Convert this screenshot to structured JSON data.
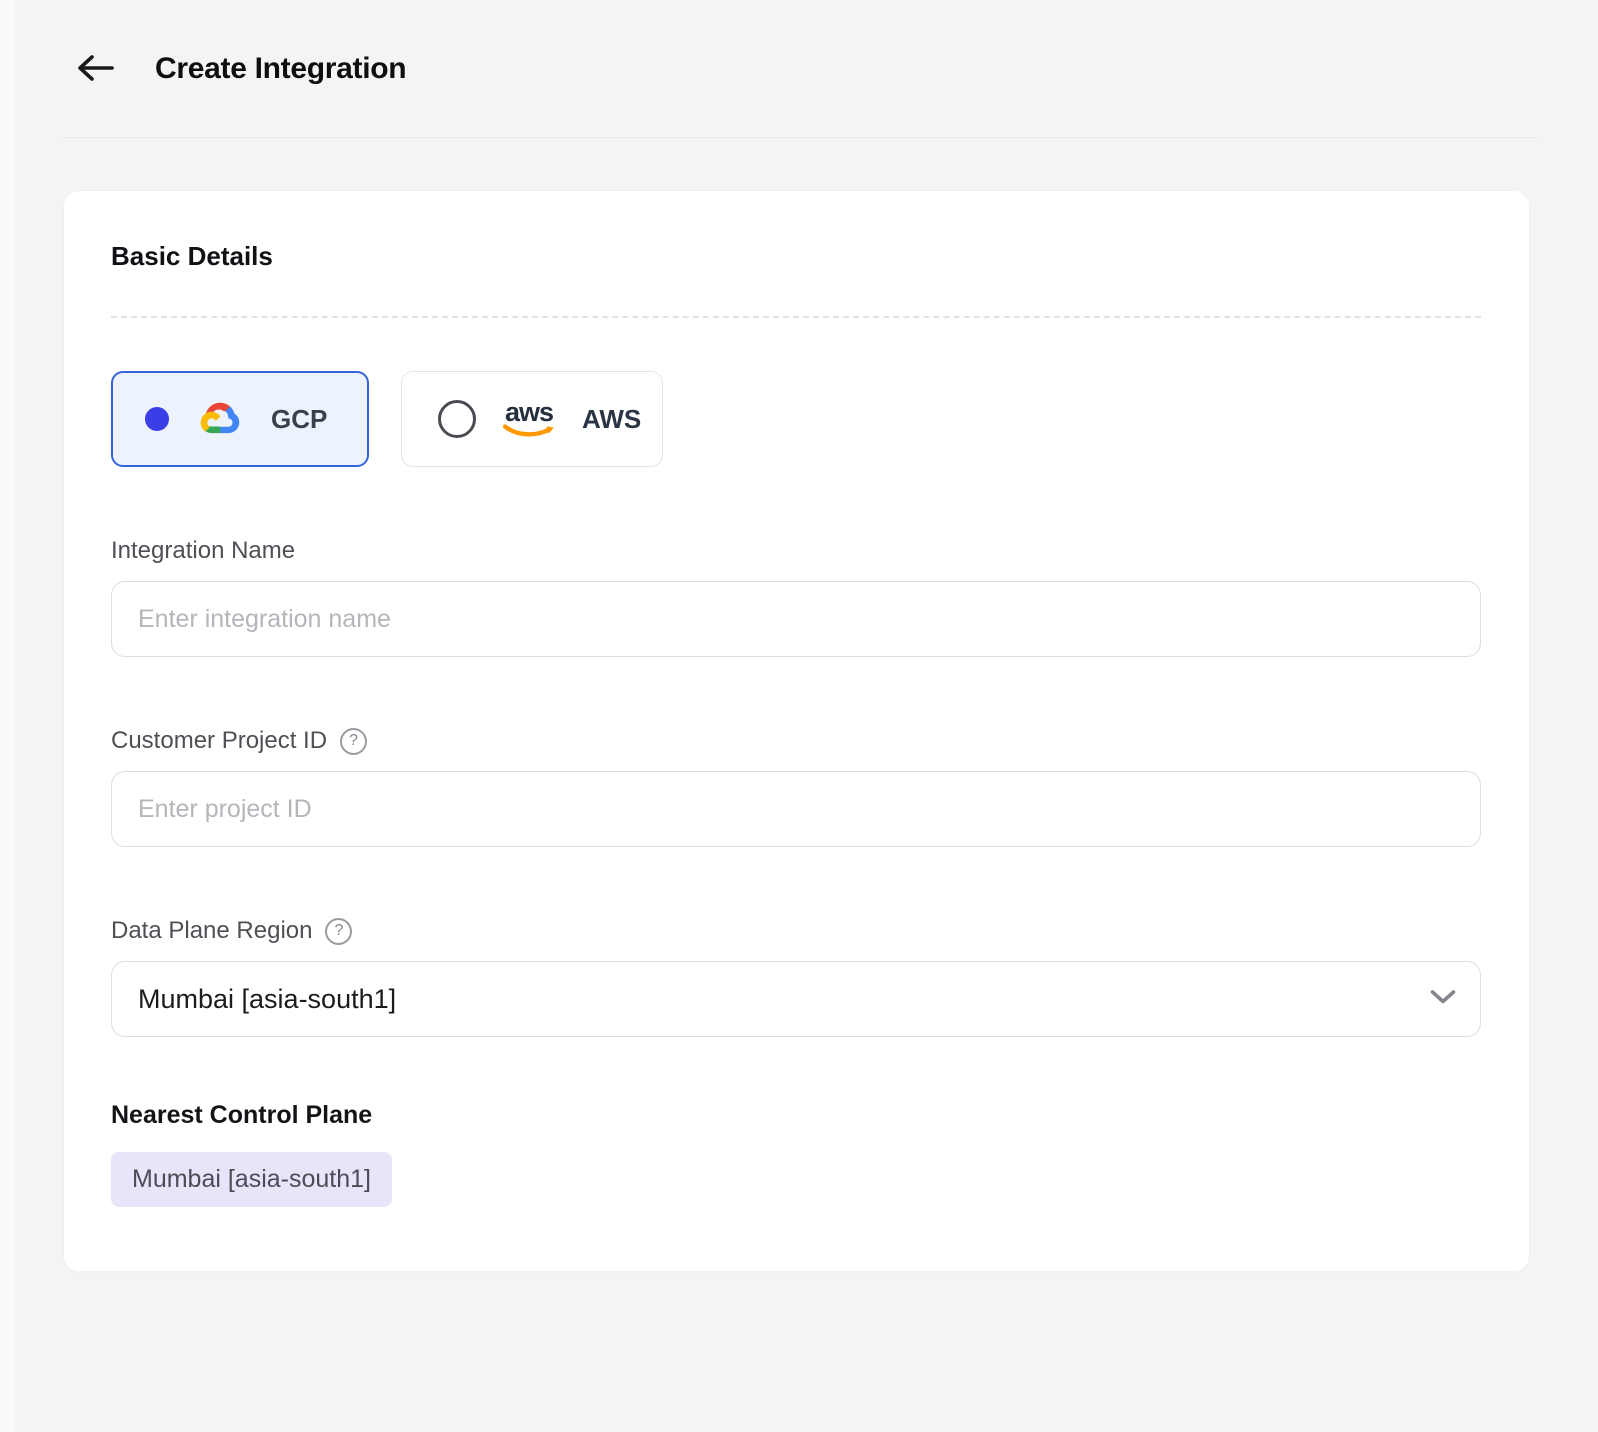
{
  "header": {
    "title": "Create Integration"
  },
  "basic_details": {
    "title": "Basic Details",
    "providers": [
      {
        "label": "GCP",
        "selected": true
      },
      {
        "label": "AWS",
        "selected": false,
        "logo_text": "aws"
      }
    ],
    "integration_name": {
      "label": "Integration Name",
      "placeholder": "Enter integration name",
      "value": ""
    },
    "customer_project_id": {
      "label": "Customer Project ID",
      "placeholder": "Enter project ID",
      "value": ""
    },
    "data_plane_region": {
      "label": "Data Plane Region",
      "selected_option": "Mumbai [asia-south1]"
    },
    "nearest_control_plane": {
      "label": "Nearest Control Plane",
      "value": "Mumbai [asia-south1]"
    }
  },
  "icons": {
    "back": "arrow-left",
    "help_glyph": "?",
    "chevron": "chevron-down",
    "gcp_logo": "google-cloud-logo",
    "aws_logo": "aws-logo"
  },
  "colors": {
    "selected_border": "#3564da",
    "selected_bg": "#edf3fc",
    "radio_blue": "#3b3ee6",
    "aws_orange": "#ff9900",
    "aws_navy": "#252f3e",
    "badge_bg": "#e7e5f9",
    "gcp_red": "#ea4535",
    "gcp_blue": "#4285f4",
    "gcp_green": "#34a853",
    "gcp_yellow": "#fbbc05"
  }
}
